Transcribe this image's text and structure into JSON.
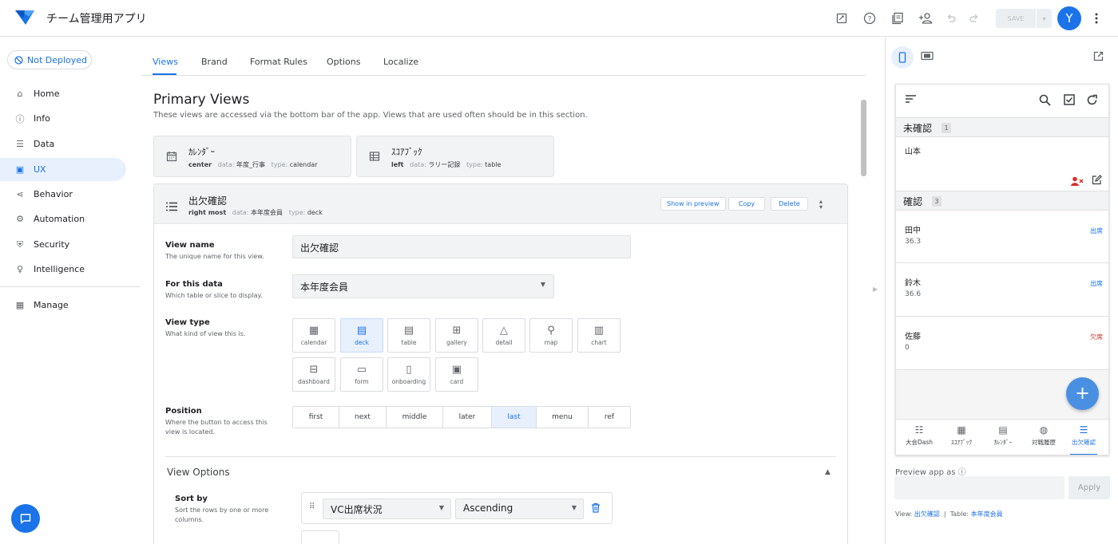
{
  "app": {
    "title": "チーム管理用アプリ"
  },
  "toolbar": {
    "save_label": "SAVE",
    "avatar_letter": "Y"
  },
  "sidebar": {
    "deploy_status": "Not Deployed",
    "items": [
      {
        "label": "Home",
        "icon": "home-icon"
      },
      {
        "label": "Info",
        "icon": "info-icon"
      },
      {
        "label": "Data",
        "icon": "data-icon"
      },
      {
        "label": "UX",
        "icon": "ux-icon",
        "active": true
      },
      {
        "label": "Behavior",
        "icon": "behavior-icon"
      },
      {
        "label": "Automation",
        "icon": "automation-icon"
      },
      {
        "label": "Security",
        "icon": "security-icon"
      },
      {
        "label": "Intelligence",
        "icon": "intelligence-icon"
      },
      {
        "label": "Manage",
        "icon": "manage-icon"
      }
    ]
  },
  "tabs": [
    "Views",
    "Brand",
    "Format Rules",
    "Options",
    "Localize"
  ],
  "main": {
    "section_title": "Primary Views",
    "section_desc": "These views are accessed via the bottom bar of the app. Views that are used often should be in this section.",
    "view_cards": [
      {
        "name": "ｶﾚﾝﾀﾞｰ",
        "position": "center",
        "data_label": "data:",
        "data": "年度_行事",
        "type_label": "type:",
        "type": "calendar"
      },
      {
        "name": "ｽｺｱﾌﾞｯｸ",
        "position": "left",
        "data_label": "data:",
        "data": "ラリー記録",
        "type_label": "type:",
        "type": "table"
      }
    ],
    "detail": {
      "name": "出欠確認",
      "position": "right most",
      "data_label": "data:",
      "data": "本年度会員",
      "type_label": "type:",
      "type": "deck",
      "buttons": {
        "show_preview": "Show in preview",
        "copy": "Copy",
        "delete": "Delete"
      },
      "view_name": {
        "label": "View name",
        "help": "The unique name for this view.",
        "value": "出欠確認"
      },
      "for_data": {
        "label": "For this data",
        "help": "Which table or slice to display.",
        "value": "本年度会員"
      },
      "view_type": {
        "label": "View type",
        "help": "What kind of view this is.",
        "options": [
          "calendar",
          "deck",
          "table",
          "gallery",
          "detail",
          "map",
          "chart",
          "dashboard",
          "form",
          "onboarding",
          "card"
        ],
        "selected": "deck"
      },
      "position_field": {
        "label": "Position",
        "help": "Where the button to access this view is located.",
        "options": [
          "first",
          "next",
          "middle",
          "later",
          "last",
          "menu",
          "ref"
        ],
        "selected": "last"
      },
      "view_options_title": "View Options",
      "sort": {
        "label": "Sort by",
        "help": "Sort the rows by one or more columns.",
        "column": "VC出席状況",
        "order": "Ascending"
      }
    }
  },
  "preview": {
    "groups": [
      {
        "title": "未確認",
        "count": "1",
        "rows": [
          {
            "name": "山本"
          }
        ]
      },
      {
        "title": "確認",
        "count": "3",
        "rows": [
          {
            "name": "田中",
            "value": "36.3",
            "status": "出席"
          },
          {
            "name": "鈴木",
            "value": "36.6",
            "status": "出席"
          },
          {
            "name": "佐藤",
            "value": "0",
            "status": "欠席"
          }
        ]
      }
    ],
    "bottom_nav": [
      {
        "label": "大会Dash",
        "icon": "list-numbered-icon"
      },
      {
        "label": "ｽｺｱﾌﾞｯｸ",
        "icon": "table-icon"
      },
      {
        "label": "ｶﾚﾝﾀﾞｰ",
        "icon": "calendar-icon"
      },
      {
        "label": "対戦履歴",
        "icon": "volleyball-icon"
      },
      {
        "label": "出欠確認",
        "icon": "list-icon",
        "active": true
      }
    ],
    "preview_as_label": "Preview app as",
    "apply_label": "Apply",
    "footer": {
      "view_label": "View:",
      "view": "出欠確認",
      "sep": "|",
      "table_label": "Table:",
      "table": "本年度会員"
    }
  },
  "colors": {
    "accent": "#1a73e8",
    "present": "#1a73e8",
    "absent": "#d93025",
    "fab": "#4a90e2"
  }
}
